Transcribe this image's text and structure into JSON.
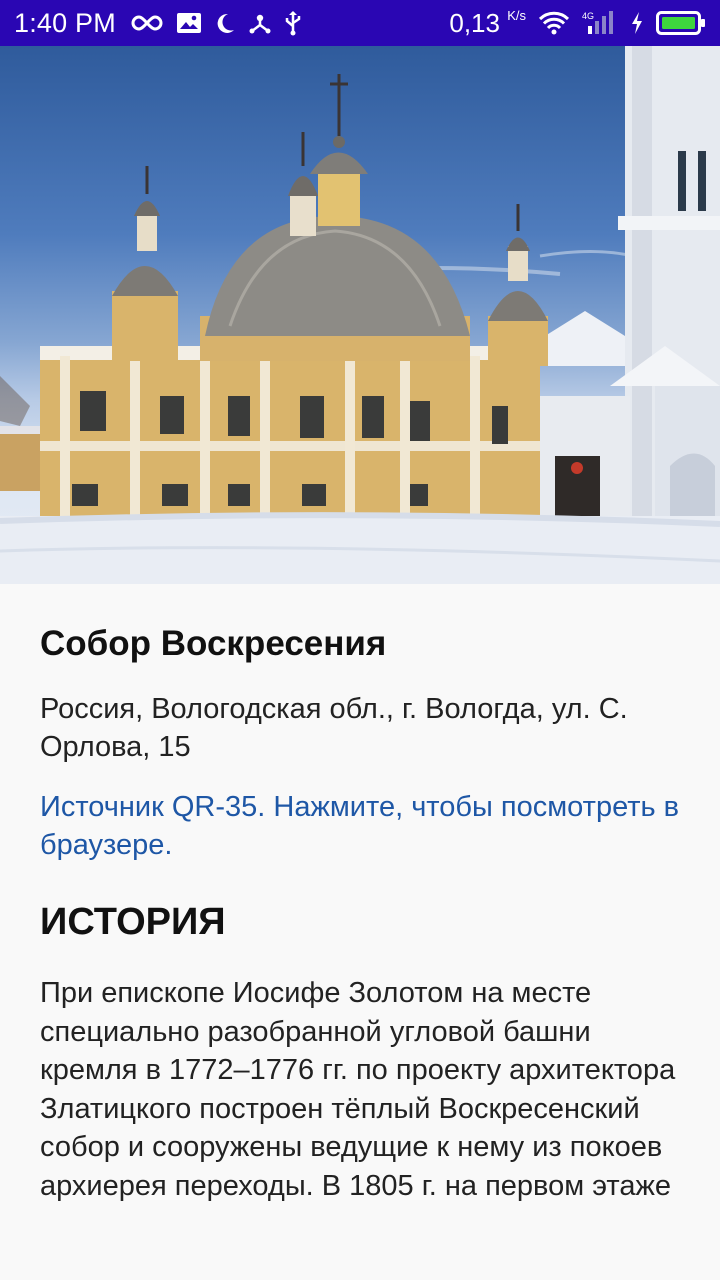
{
  "status_bar": {
    "time": "1:40 PM",
    "speed": "0,13",
    "speed_unit": "K/s",
    "network": "4G",
    "icons": [
      "infinity-icon",
      "image-icon",
      "moon-icon",
      "usb-icon",
      "wifi-icon",
      "signal-icon",
      "charging-icon",
      "battery-icon"
    ],
    "bg_color": "#2a06b3"
  },
  "hero": {
    "icon": "cathedral-photo"
  },
  "place": {
    "title": "Собор Воскресения",
    "address": "Россия, Вологодская обл., г. Вологда, ул. С. Орлова, 15",
    "source_link": "Источник QR-35. Нажмите, чтобы посмотреть в браузере.",
    "link_color": "#1e57a6"
  },
  "history": {
    "heading": "ИСТОРИЯ",
    "text": "При епископе Иосифе Золотом на месте специально разобранной угловой башни кремля в 1772–1776 гг. по проекту архитектора Златицкого построен тёплый Воскресенский собор и сооружены ведущие к нему из покоев архиерея переходы. В 1805 г. на первом этаже"
  }
}
